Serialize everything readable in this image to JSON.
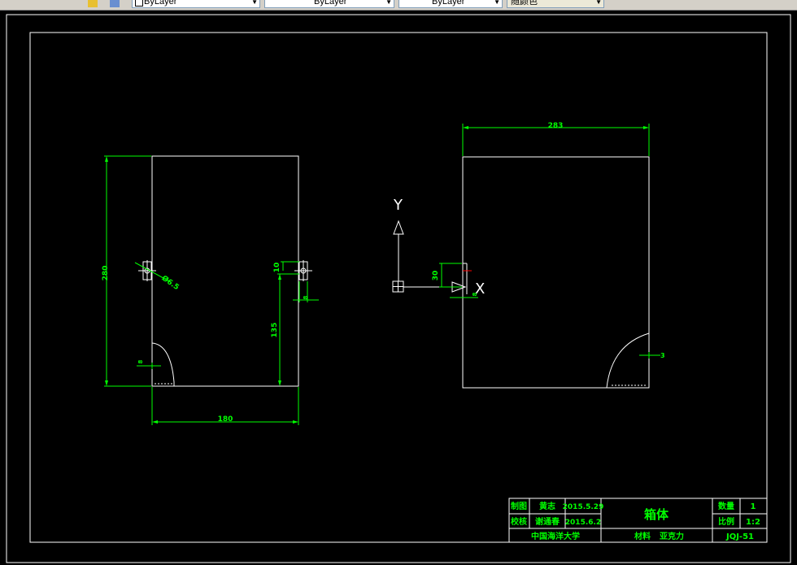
{
  "toolbar": {
    "linetype_combo": "ByLayer",
    "lineweight_combo": "ByLayer",
    "plotstyle_combo": "ByLayer",
    "color_combo": "随颜色"
  },
  "drawing": {
    "dims": {
      "left_height": "280",
      "left_width": "180",
      "left_hole_dia": "Ø6.5",
      "left_hole_offset": "10",
      "left_hole_from_bottom": "135",
      "left_hole_right_small": "8",
      "left_quarter_dim": "8",
      "right_width": "283",
      "ucs_dim_left": "30",
      "ucs_dim_small": "8",
      "right_arc_dim": "3"
    },
    "ucs": {
      "y_label": "Y",
      "x_label": "X"
    }
  },
  "title_block": {
    "drawn_by_label": "制图",
    "drawn_by_name": "黄志",
    "drawn_date": "2015.5.29",
    "checked_by_label": "校核",
    "checked_by_name": "谢通春",
    "checked_date": "2015.6.2",
    "school": "中国海洋大学",
    "part_name": "箱体",
    "material_label": "材料",
    "material_value": "亚克力",
    "quantity_label": "数量",
    "quantity_value": "1",
    "scale_label": "比例",
    "scale_value": "1:2",
    "drawing_no": "JQJ-51"
  },
  "colors": {
    "background": "#000000",
    "geometry": "#ffffff",
    "dimension": "#00ff00",
    "accent": "#ff0000"
  }
}
